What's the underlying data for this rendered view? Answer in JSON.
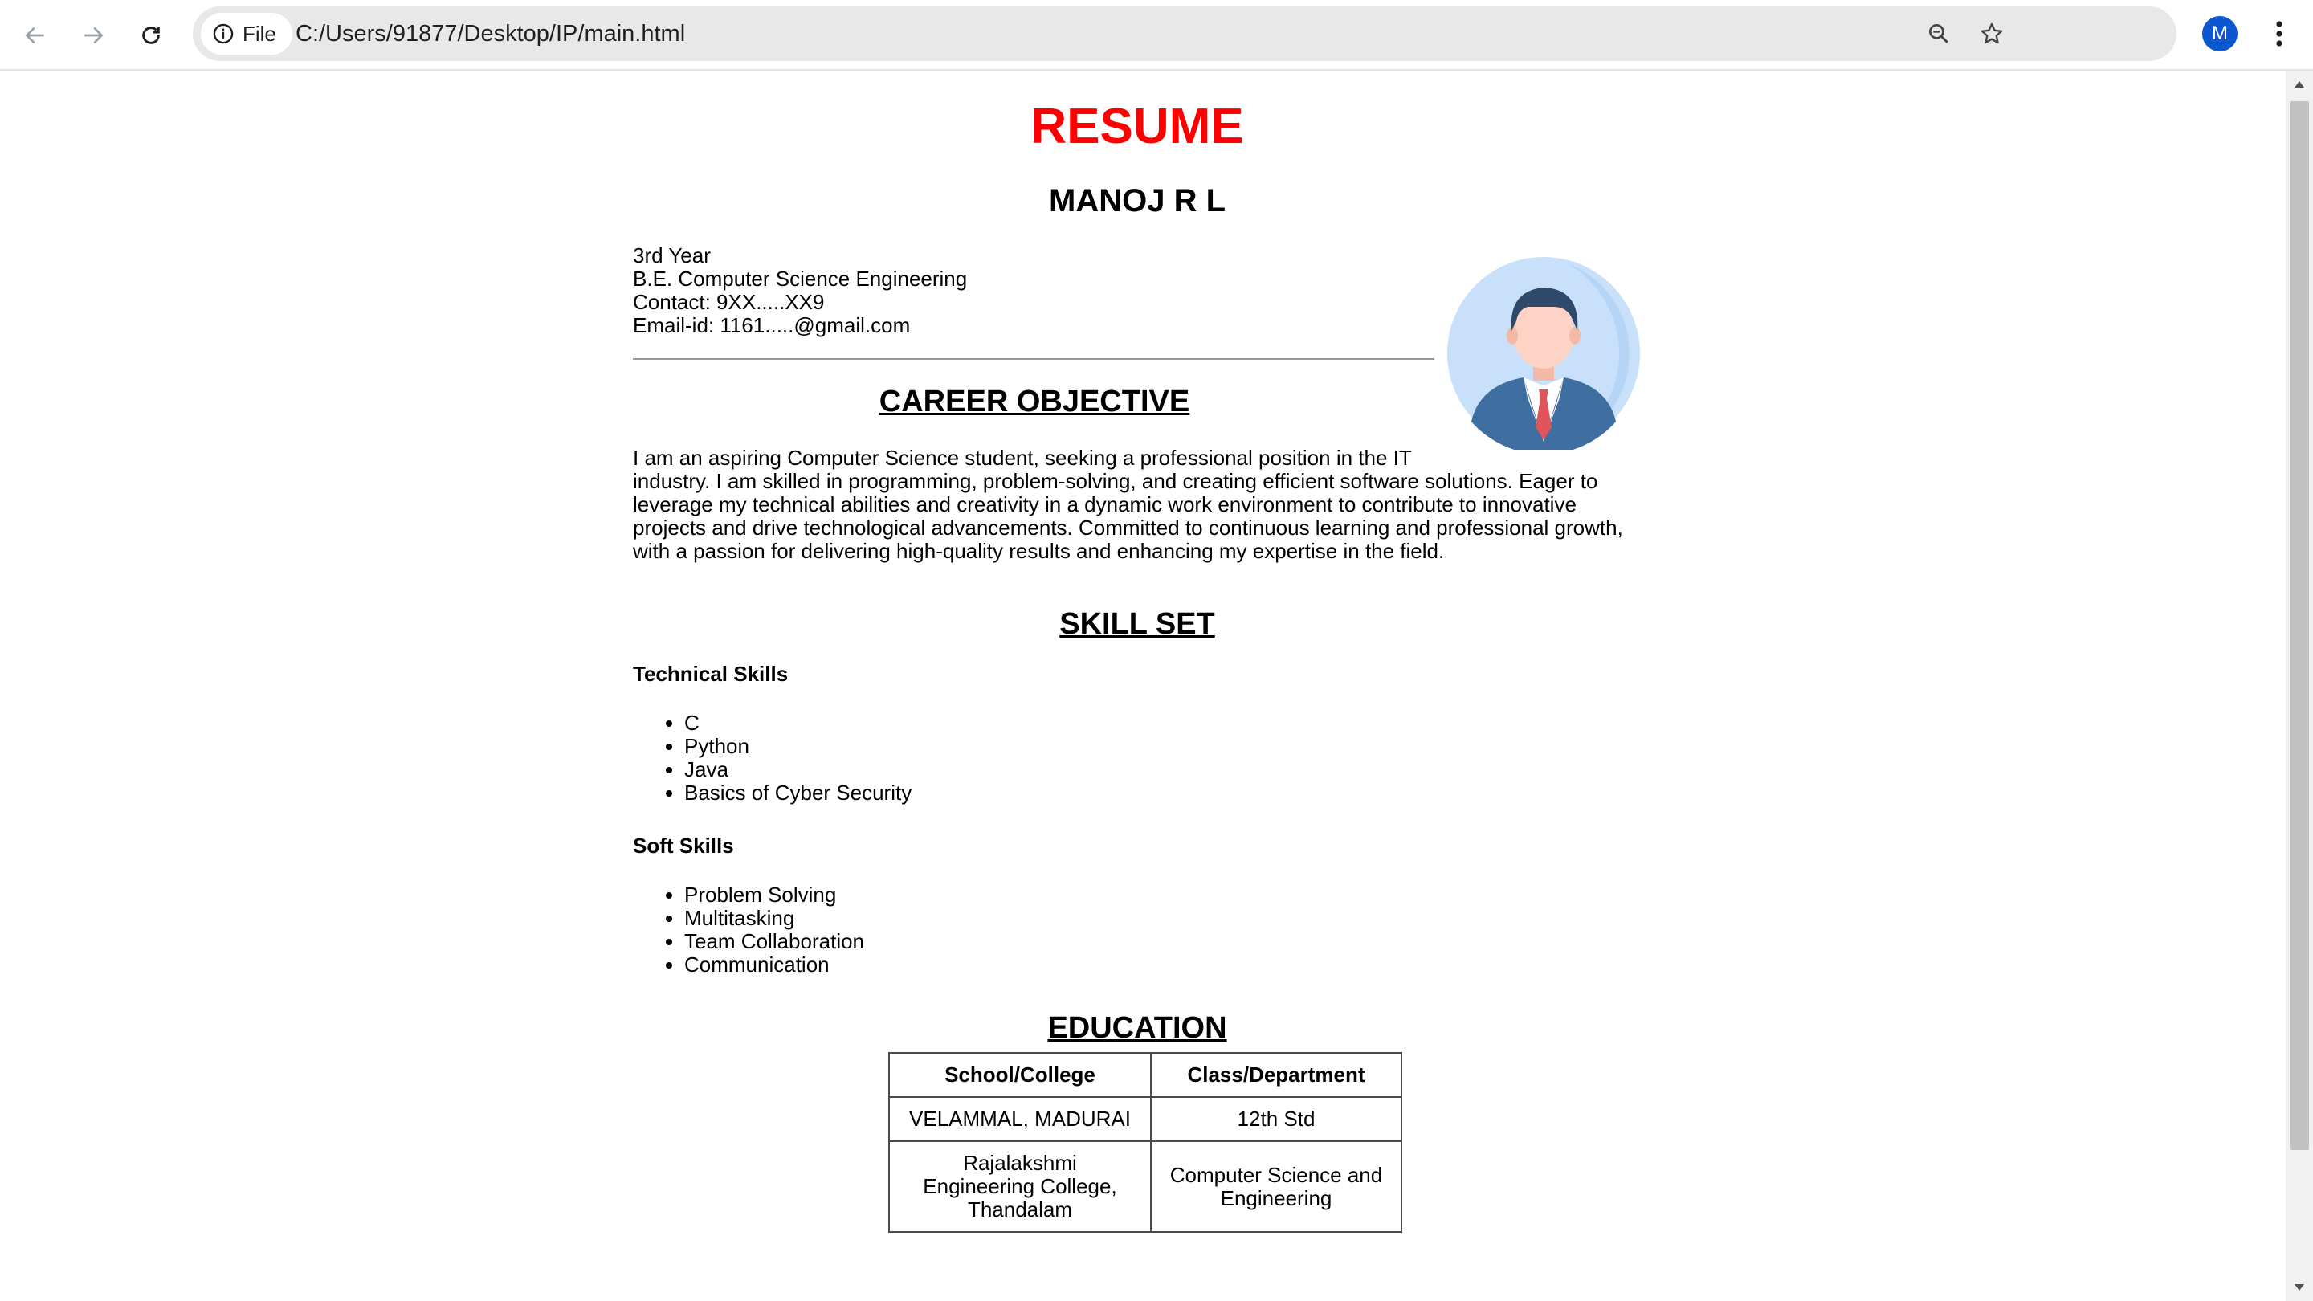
{
  "browser": {
    "security_label": "File",
    "url": "C:/Users/91877/Desktop/IP/main.html",
    "profile_initial": "M"
  },
  "resume": {
    "title": "RESUME",
    "name": "MANOJ R L",
    "info": {
      "year": "3rd Year",
      "degree": "B.E. Computer Science Engineering",
      "contact": "Contact: 9XX.....XX9",
      "email": "Email-id: 1161.....@gmail.com"
    },
    "career": {
      "heading": "CAREER OBJECTIVE",
      "line1": "I am an aspiring Computer Science student, seeking a professional position in the IT",
      "rest": "industry. I am skilled in programming, problem-solving, and creating efficient software solutions. Eager to leverage my technical abilities and creativity in a dynamic work environment to contribute to innovative projects and drive technological advancements. Committed to continuous learning and professional growth, with a passion for delivering high-quality results and enhancing my expertise in the field."
    },
    "skills": {
      "heading": "SKILL SET",
      "technical_heading": "Technical Skills",
      "technical": [
        "C",
        "Python",
        "Java",
        "Basics of Cyber Security"
      ],
      "soft_heading": "Soft Skills",
      "soft": [
        "Problem Solving",
        "Multitasking",
        "Team Collaboration",
        "Communication"
      ]
    },
    "education": {
      "heading": "EDUCATION",
      "columns": [
        "School/College",
        "Class/Department"
      ],
      "rows": [
        [
          "VELAMMAL, MADURAI",
          "12th Std"
        ],
        [
          "Rajalakshmi Engineering College, Thandalam",
          "Computer Science and Engineering"
        ]
      ]
    }
  },
  "colors": {
    "title": "#ff0000",
    "avatar_bg": "#c9e0fb",
    "profile_badge": "#0b57d0"
  }
}
